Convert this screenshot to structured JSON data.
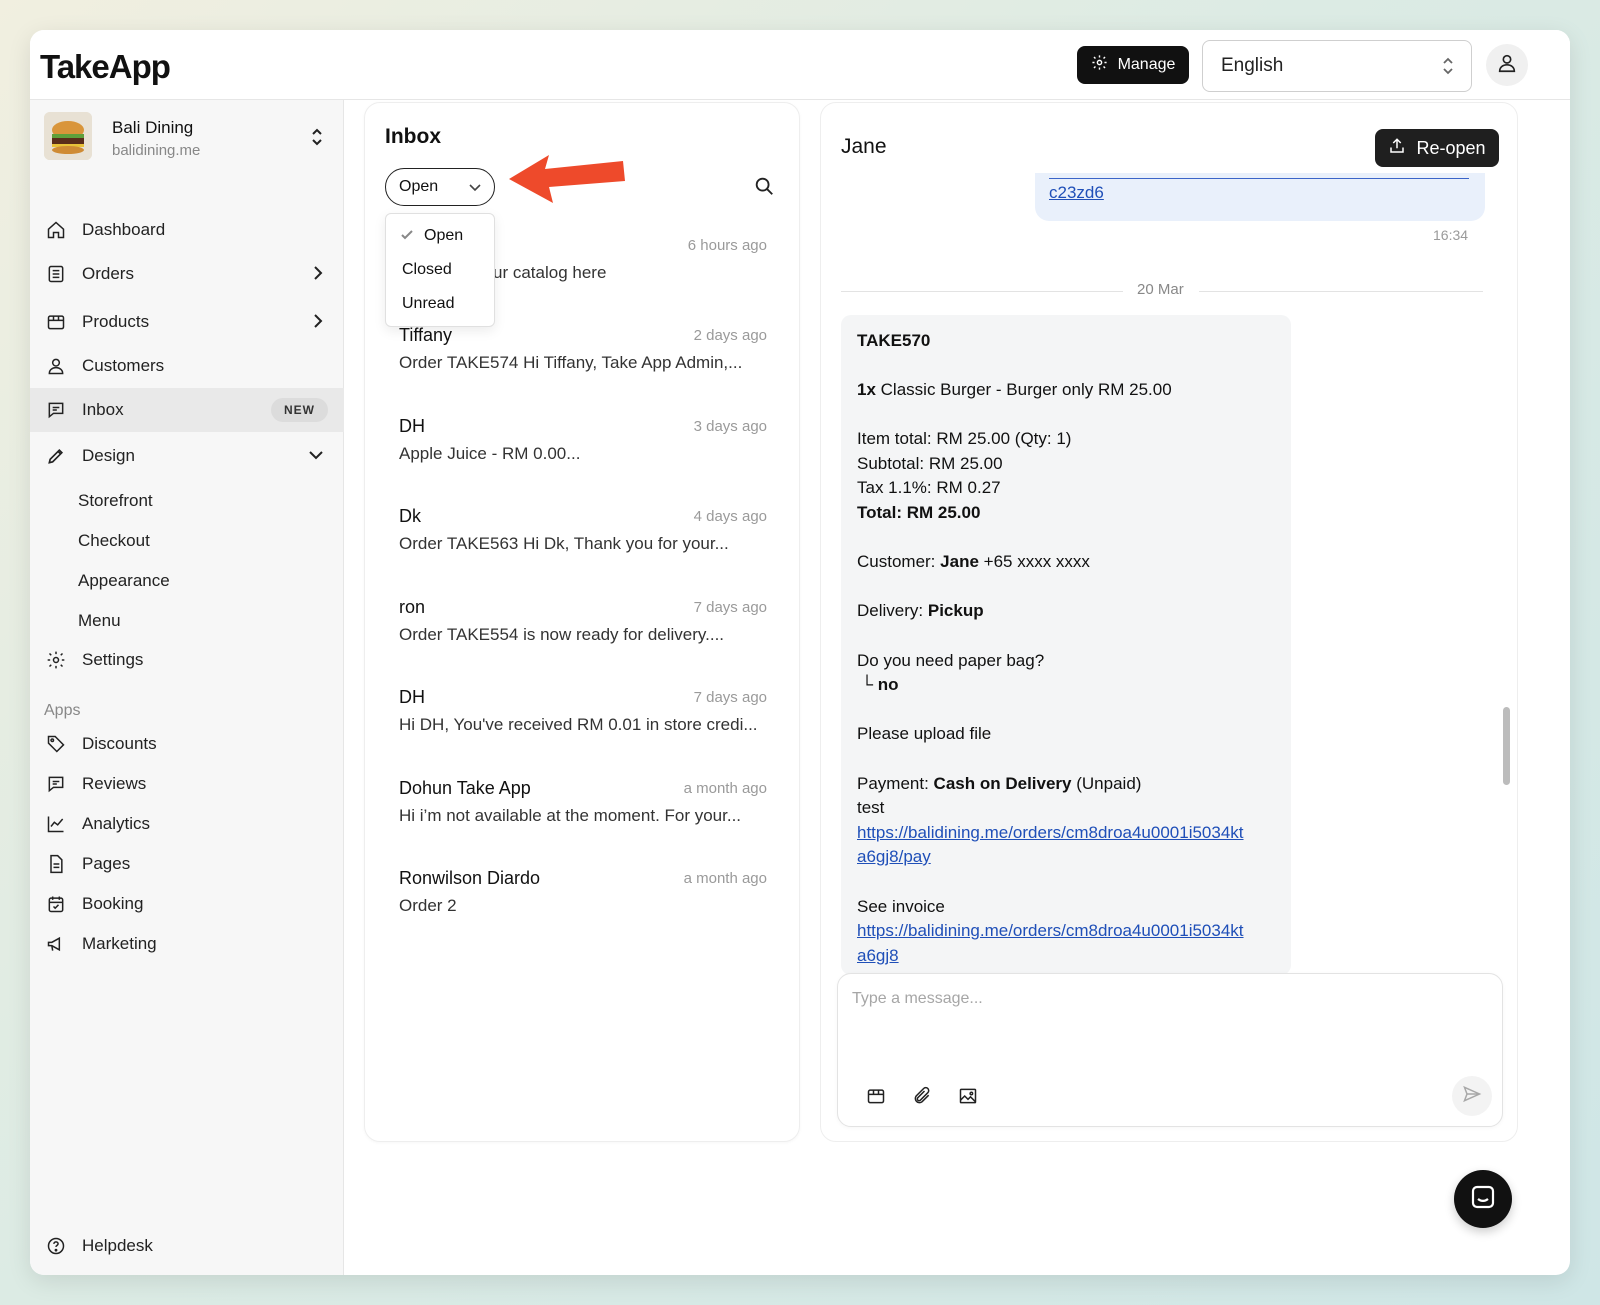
{
  "app": {
    "logo": "TakeApp"
  },
  "header": {
    "manage_label": "Manage",
    "language": "English"
  },
  "store": {
    "name": "Bali Dining",
    "domain": "balidining.me"
  },
  "sidebar": {
    "dashboard": "Dashboard",
    "orders": "Orders",
    "products": "Products",
    "customers": "Customers",
    "inbox": "Inbox",
    "inbox_badge": "NEW",
    "design": "Design",
    "design_sub": [
      "Storefront",
      "Checkout",
      "Appearance",
      "Menu"
    ],
    "settings": "Settings",
    "apps_label": "Apps",
    "apps": [
      "Discounts",
      "Reviews",
      "Analytics",
      "Pages",
      "Booking",
      "Marketing"
    ],
    "helpdesk": "Helpdesk"
  },
  "inbox": {
    "title": "Inbox",
    "filter_value": "Open",
    "filter_options": [
      "Open",
      "Closed",
      "Unread"
    ],
    "first_partial": {
      "time": "6 hours ago",
      "preview_tail": "ur catalog here"
    },
    "conversations": [
      {
        "name": "Tiffany",
        "time": "2 days ago",
        "preview": "Order TAKE574 Hi Tiffany, Take App Admin,..."
      },
      {
        "name": "DH",
        "time": "3 days ago",
        "preview": "Apple Juice - RM 0.00..."
      },
      {
        "name": "Dk",
        "time": "4 days ago",
        "preview": "Order TAKE563 Hi Dk, Thank you for your..."
      },
      {
        "name": "ron",
        "time": "7 days ago",
        "preview": "Order TAKE554 is now ready for delivery...."
      },
      {
        "name": "DH",
        "time": "7 days ago",
        "preview": "Hi DH, You've received RM 0.01 in store credi..."
      },
      {
        "name": "Dohun Take App",
        "time": "a month ago",
        "preview": "Hi i’m not available at the moment. For your..."
      },
      {
        "name": "Ronwilson Diardo",
        "time": "a month ago",
        "preview": "Order 2"
      }
    ]
  },
  "chat": {
    "contact_name": "Jane",
    "reopen_label": "Re-open",
    "prev_link_tail": "c23zd6",
    "prev_time": "16:34",
    "date_separator": "20 Mar",
    "order": {
      "code": "TAKE570",
      "item_qty": "1x",
      "item_text": "Classic Burger - Burger only RM 25.00",
      "item_total": "Item total: RM 25.00 (Qty: 1)",
      "subtotal": "Subtotal: RM 25.00",
      "tax": "Tax 1.1%: RM 0.27",
      "total": "Total: RM 25.00",
      "customer_label": "Customer:",
      "customer_name": "Jane",
      "customer_phone": "+65 xxxx xxxx",
      "delivery_label": "Delivery:",
      "delivery_value": "Pickup",
      "question": "Do you need paper bag?",
      "answer_prefix": "└",
      "answer": "no",
      "upload": "Please upload file",
      "payment_label": "Payment:",
      "payment_method": "Cash on Delivery",
      "payment_status": "(Unpaid)",
      "note": "test",
      "pay_link_1": "https://balidining.me/orders/cm8droa4u0001i5034kt",
      "pay_link_2": "a6gj8/pay",
      "invoice_label": "See invoice",
      "invoice_link_1": "https://balidining.me/orders/cm8droa4u0001i5034kt",
      "invoice_link_2": "a6gj8"
    },
    "composer_placeholder": "Type a message..."
  },
  "colors": {
    "accent_arrow": "#ee4a2b",
    "link": "#1f4fb8",
    "dark_button": "#111111"
  }
}
